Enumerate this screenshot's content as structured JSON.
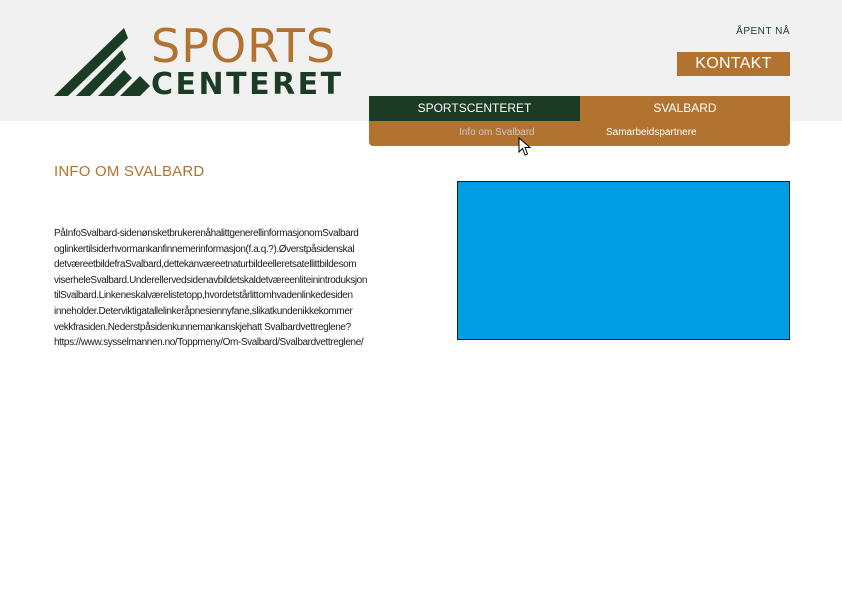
{
  "logo": {
    "word1": "SPORTS",
    "word2": "CENTERET"
  },
  "header": {
    "open_now": "ÅPENT NÅ",
    "contact_label": "KONTAKT"
  },
  "nav": {
    "items": [
      {
        "label": "SPORTSCENTERET"
      },
      {
        "label": "SVALBARD"
      }
    ],
    "subitems": [
      {
        "label": "Info om Svalbard"
      },
      {
        "label": "Samarbeidspartnere"
      }
    ]
  },
  "main": {
    "title": "INFO OM SVALBARD",
    "text_lines": [
      "PåInfoSvalbard-sidenønsketbrukerenåhalittgenerellinformasjonomSvalbard",
      "oglinkertilsiderhvormankanfinnemerinformasjon(f.a.q.?).Øverstpåsidenskal",
      "detværeetbildefraSvalbard,dettekanværeetnaturbildeelleretsatellittbildesom",
      "viserheleSvalbard.Underellervedsidenavbildetskaldetværeenliteinintroduksjon",
      "tilSvalbard.Linkeneskalværelistetopp,hvordetstårlittomhvadenlinkedesiden",
      "inneholder.Deterviktigatallelinkeråpnesiennyfane,slikatkundenikkekommer",
      "vekkfrasiden.Nederstpåsidenkunnemankanskjehatt Svalbardvettreglene?",
      "https://www.sysselmannen.no/Toppmeny/Om-Svalbard/Svalbardvettreglene/"
    ]
  },
  "colors": {
    "brand_green": "#1c3b24",
    "brand_brown": "#b27330",
    "image_placeholder": "#009fe3",
    "header_bg": "#f1f1f2"
  }
}
